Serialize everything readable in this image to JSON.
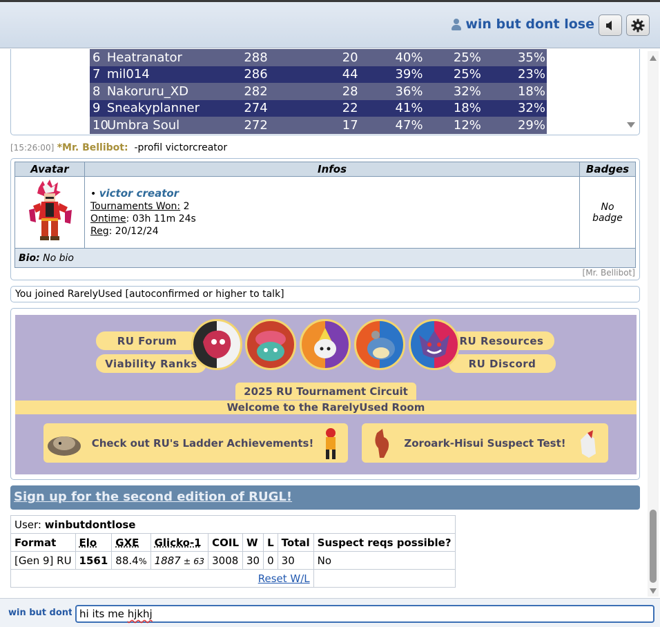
{
  "header": {
    "username": "win but dont lose",
    "icons": {
      "user": "user-icon",
      "sound": "speaker-icon",
      "settings": "gear-icon"
    }
  },
  "ladder": {
    "rows": [
      {
        "rank": "6",
        "name": "Heatranator",
        "elo": "288",
        "games": "20",
        "a": "40%",
        "b": "25%",
        "c": "35%"
      },
      {
        "rank": "7",
        "name": "mil014",
        "elo": "286",
        "games": "44",
        "a": "39%",
        "b": "25%",
        "c": "23%"
      },
      {
        "rank": "8",
        "name": "Nakoruru_XD",
        "elo": "282",
        "games": "28",
        "a": "36%",
        "b": "32%",
        "c": "18%"
      },
      {
        "rank": "9",
        "name": "Sneakyplanner",
        "elo": "274",
        "games": "22",
        "a": "41%",
        "b": "18%",
        "c": "32%"
      },
      {
        "rank": "10",
        "name": "Umbra Soul",
        "elo": "272",
        "games": "17",
        "a": "47%",
        "b": "12%",
        "c": "29%"
      }
    ]
  },
  "chat": {
    "timestamp": "[15:26:00]",
    "rank_symbol": "*",
    "sender": "Mr. Bellibot:",
    "message": "-profil victorcreator"
  },
  "profile": {
    "headers": {
      "avatar": "Avatar",
      "infos": "Infos",
      "badges": "Badges"
    },
    "bullet": "•",
    "name": "victor creator",
    "tournaments_label": "Tournaments Won:",
    "tournaments_value": "2",
    "ontime_label": "Ontime",
    "ontime_value": ": 03h 11m 24s",
    "reg_label": "Reg",
    "reg_value": ": 20/12/24",
    "badges_line1": "No",
    "badges_line2": "badge",
    "bio_label": "Bio:",
    "bio_value": "No bio",
    "bot_tag": "[Mr. Bellibot]"
  },
  "joined_msg": "You joined RarelyUsed [autoconfirmed or higher to talk]",
  "banner": {
    "forum": "RU Forum",
    "viability": "Viability Ranks",
    "resources": "RU Resources",
    "discord": "RU Discord",
    "circuit": "2025 RU Tournament Circuit",
    "welcome": "Welcome to the RarelyUsed Room",
    "card1": "Check out RU's Ladder Achievements!",
    "card2": "Zoroark-Hisui Suspect Test!"
  },
  "rugl": {
    "link": "Sign up for the second edition of RUGL!"
  },
  "user_ladder": {
    "user_label": "User:",
    "user_value": "winbutdontlose",
    "headers": [
      "Format",
      "Elo",
      "GXE",
      "Glicko-1",
      "COIL",
      "W",
      "L",
      "Total",
      "Suspect reqs possible?"
    ],
    "format": "[Gen 9] RU",
    "elo": "1561",
    "gxe": "88.4",
    "gxe_unit": "%",
    "glicko": "1887",
    "glicko_dev": " ± 63",
    "coil": "3008",
    "w": "30",
    "l": "0",
    "total": "30",
    "suspect": "No",
    "reset": "Reset W/L"
  },
  "input": {
    "username": "win but dont lose:",
    "text_a": "hi its me ",
    "text_b": "hjkhj"
  }
}
